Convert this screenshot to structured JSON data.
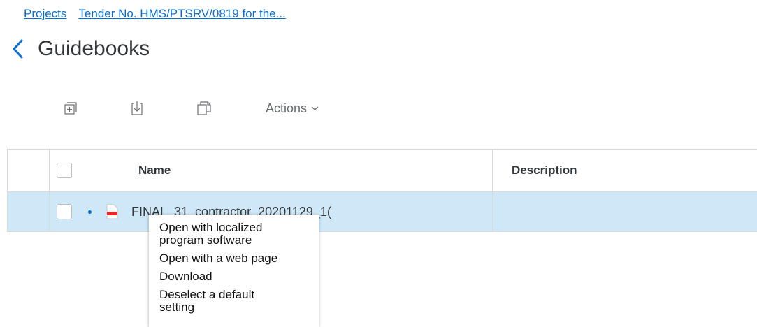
{
  "breadcrumb": {
    "items": [
      {
        "label": "Projects"
      },
      {
        "label": "Tender No. HMS/PTSRV/0819 for the..."
      }
    ]
  },
  "page": {
    "title": "Guidebooks"
  },
  "toolbar": {
    "actions_label": "Actions",
    "icons": [
      "add-icon",
      "download-icon",
      "copy-icon"
    ]
  },
  "table": {
    "columns": [
      "Name",
      "Description"
    ],
    "rows": [
      {
        "name": "FINAL_31_contractor_20201129_1(",
        "description": "",
        "selected": true
      }
    ]
  },
  "context_menu": {
    "items": [
      {
        "label": "Open with localized program software"
      },
      {
        "label": "Open with a web page"
      },
      {
        "label": "Download"
      },
      {
        "label": "Deselect a default setting"
      }
    ]
  },
  "colors": {
    "link": "#0a6ed1",
    "selected_row": "#cfe8f7",
    "file_icon_red": "#e52727"
  }
}
